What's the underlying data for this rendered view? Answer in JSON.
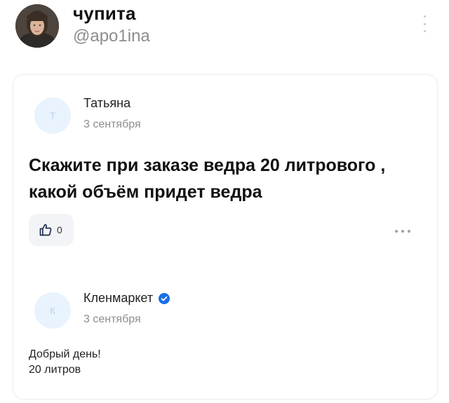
{
  "post": {
    "author_name": "чупита",
    "author_handle": "@apo1ina"
  },
  "review": {
    "avatar_letter": "Т",
    "reviewer_name": "Татьяна",
    "date": "3 сентября",
    "question": "Скажите при заказе ведра 20 литрового , какой объём придет ведра",
    "like_count": "0"
  },
  "reply": {
    "avatar_letter": "К",
    "seller_name": "Кленмаркет",
    "date": "3 сентября",
    "text_lines": [
      "Добрый день!",
      "20 литров"
    ]
  },
  "icons": {
    "more_vertical": "more-vertical-icon",
    "thumb_up": "thumb-up-icon",
    "more_horizontal": "more-horizontal-icon",
    "verified": "verified-check-icon"
  },
  "colors": {
    "verified_blue": "#1a6ee6",
    "avatar_bg": "#e9f3fd",
    "handle_gray": "#8d8d8d"
  }
}
